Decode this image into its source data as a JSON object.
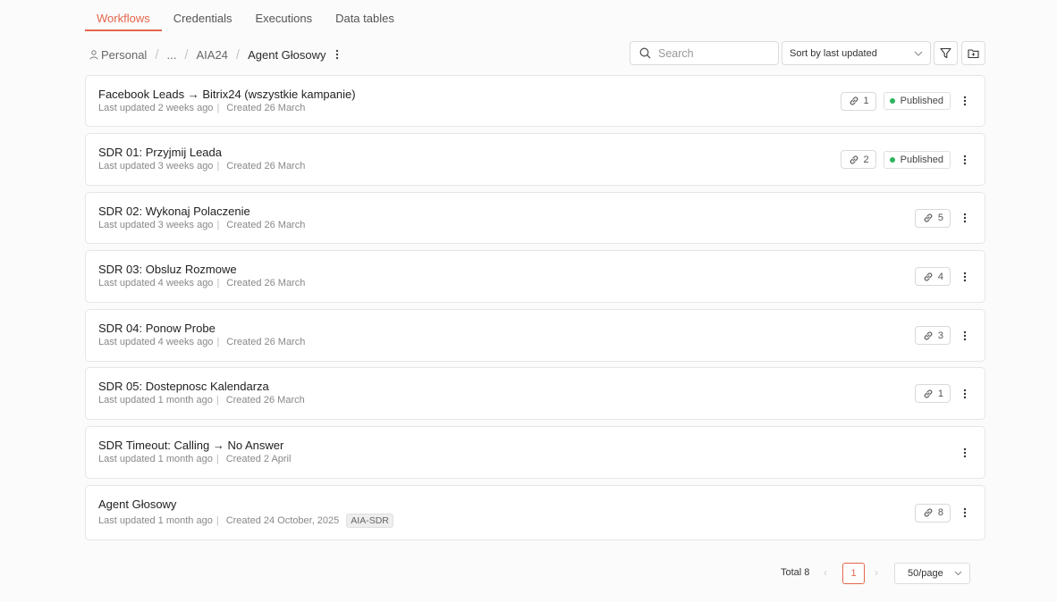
{
  "tabs": [
    {
      "label": "Workflows",
      "active": true
    },
    {
      "label": "Credentials"
    },
    {
      "label": "Executions"
    },
    {
      "label": "Data tables"
    }
  ],
  "breadcrumb": {
    "home": "Personal",
    "ellipsis": "...",
    "folder": "AIA24",
    "current": "Agent Głosowy"
  },
  "toolbar": {
    "search_placeholder": "Search",
    "sort_label": "Sort by last updated"
  },
  "workflows": [
    {
      "name": "Facebook Leads → Bitrix24 (wszystkie kampanie)",
      "updated": "Last updated 2 weeks ago",
      "created": "Created 26 March",
      "links": "1",
      "status": "Published"
    },
    {
      "name": "SDR 01: Przyjmij Leada",
      "updated": "Last updated 3 weeks ago",
      "created": "Created 26 March",
      "links": "2",
      "status": "Published"
    },
    {
      "name": "SDR 02: Wykonaj Polaczenie",
      "updated": "Last updated 3 weeks ago",
      "created": "Created 26 March",
      "links": "5"
    },
    {
      "name": "SDR 03: Obsluz Rozmowe",
      "updated": "Last updated 4 weeks ago",
      "created": "Created 26 March",
      "links": "4"
    },
    {
      "name": "SDR 04: Ponow Probe",
      "updated": "Last updated 4 weeks ago",
      "created": "Created 26 March",
      "links": "3"
    },
    {
      "name": "SDR 05: Dostepnosc Kalendarza",
      "updated": "Last updated 1 month ago",
      "created": "Created 26 March",
      "links": "1"
    },
    {
      "name": "SDR Timeout: Calling → No Answer",
      "updated": "Last updated 1 month ago",
      "created": "Created 2 April"
    },
    {
      "name": "Agent Głosowy",
      "updated": "Last updated 1 month ago",
      "created": "Created 24 October, 2025",
      "tag": "AIA-SDR",
      "links": "8"
    }
  ],
  "pagination": {
    "total": "Total 8",
    "page": "1",
    "per_page": "50/page"
  },
  "colors": {
    "accent": "#e4674b",
    "published_dot": "#2bb45d"
  }
}
